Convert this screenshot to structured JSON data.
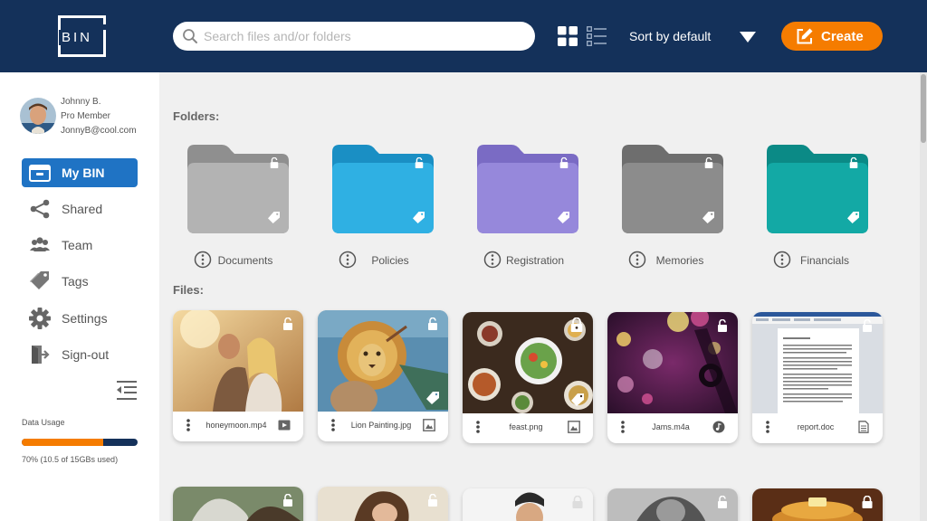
{
  "app": {
    "logo_text": "BIN"
  },
  "header": {
    "search_placeholder": "Search files and/or folders",
    "search_value": "",
    "sort_label": "Sort by default",
    "create_label": "Create"
  },
  "user": {
    "name": "Johnny B.",
    "role": "Pro Member",
    "email": "JonnyB@cool.com"
  },
  "sidebar": {
    "items": [
      {
        "label": "My BIN",
        "icon": "bin-icon",
        "active": true
      },
      {
        "label": "Shared",
        "icon": "share-icon"
      },
      {
        "label": "Team",
        "icon": "team-icon"
      },
      {
        "label": "Tags",
        "icon": "tags-icon"
      },
      {
        "label": "Settings",
        "icon": "gear-icon"
      },
      {
        "label": "Sign-out",
        "icon": "signout-icon"
      }
    ],
    "usage": {
      "title": "Data Usage",
      "text": "70% (10.5 of 15GBs used)",
      "fraction": 0.7
    }
  },
  "main": {
    "folders_title": "Folders:",
    "files_title": "Files:",
    "folders": [
      {
        "label": "Documents",
        "color": "#b3b3b3",
        "tab_color": "#8f8f8f"
      },
      {
        "label": "Policies",
        "color": "#2fb0e3",
        "tab_color": "#1a8fc4"
      },
      {
        "label": "Registration",
        "color": "#9688db",
        "tab_color": "#7a6bc4"
      },
      {
        "label": "Memories",
        "color": "#8c8c8c",
        "tab_color": "#6e6e6e"
      },
      {
        "label": "Financials",
        "color": "#13a9a5",
        "tab_color": "#0b8a86"
      }
    ],
    "files": [
      {
        "name": "honeymoon.mp4",
        "type": "video-icon"
      },
      {
        "name": "Lion Painting.jpg",
        "type": "image-icon"
      },
      {
        "name": "feast.png",
        "type": "image-icon"
      },
      {
        "name": "Jams.m4a",
        "type": "music-icon"
      },
      {
        "name": "report.doc",
        "type": "document-icon"
      }
    ]
  }
}
